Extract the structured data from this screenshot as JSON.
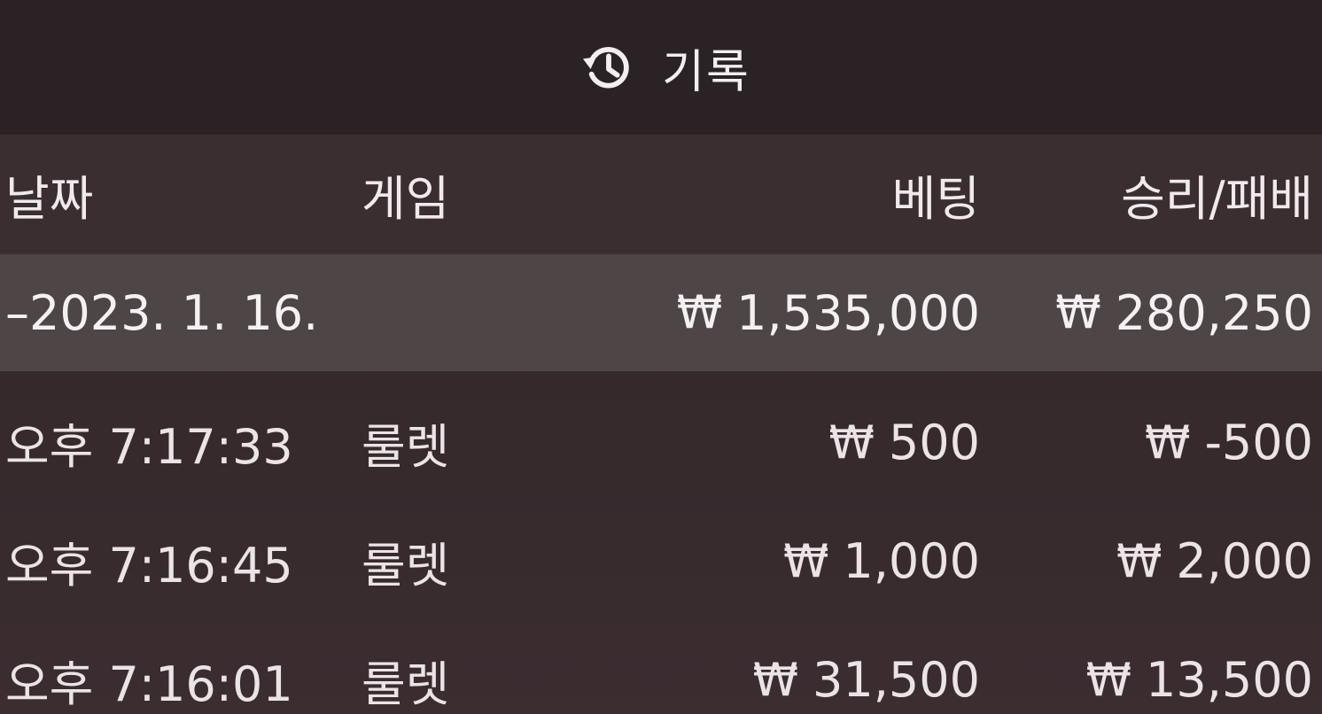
{
  "title": {
    "icon": "history-icon",
    "label": "기록"
  },
  "header": {
    "date": "날짜",
    "game": "게임",
    "bet": "베팅",
    "result": "승리/패배"
  },
  "summary": {
    "date": "–2023. 1. 16.",
    "currency": "₩",
    "bet": "1,535,000",
    "result": "280,250"
  },
  "rows": [
    {
      "time": "오후 7:17:33",
      "game": "룰렛",
      "currency": "₩",
      "bet": "500",
      "result": "-500"
    },
    {
      "time": "오후 7:16:45",
      "game": "룰렛",
      "currency": "₩",
      "bet": "1,000",
      "result": "2,000"
    },
    {
      "time": "오후 7:16:01",
      "game": "룰렛",
      "currency": "₩",
      "bet": "31,500",
      "result": "13,500"
    }
  ]
}
